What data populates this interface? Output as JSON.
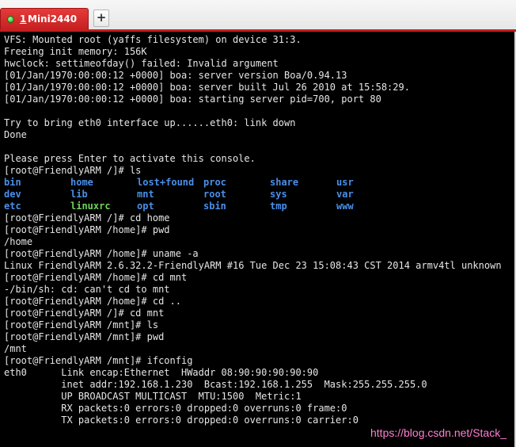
{
  "tabs": [
    {
      "number": "1",
      "title": "Mini2440",
      "status_color": "#2bbf2b",
      "active": true
    }
  ],
  "new_tab_label": "+",
  "terminal": {
    "lines_before_ls": [
      "VFS: Mounted root (yaffs filesystem) on device 31:3.",
      "Freeing init memory: 156K",
      "hwclock: settimeofday() failed: Invalid argument",
      "[01/Jan/1970:00:00:12 +0000] boa: server version Boa/0.94.13",
      "[01/Jan/1970:00:00:12 +0000] boa: server built Jul 26 2010 at 15:58:29.",
      "[01/Jan/1970:00:00:12 +0000] boa: starting server pid=700, port 80",
      "",
      "Try to bring eth0 interface up......eth0: link down",
      "Done",
      "",
      "Please press Enter to activate this console.",
      "[root@FriendlyARM /]# ls"
    ],
    "ls_rows": [
      [
        "bin",
        "home",
        "lost+found",
        "proc",
        "share",
        "usr"
      ],
      [
        "dev",
        "lib",
        "mnt",
        "root",
        "sys",
        "var"
      ],
      [
        "etc",
        "linuxrc",
        "opt",
        "sbin",
        "tmp",
        "www"
      ]
    ],
    "ls_executable": "linuxrc",
    "lines_after_ls": [
      "[root@FriendlyARM /]# cd home",
      "[root@FriendlyARM /home]# pwd",
      "/home",
      "[root@FriendlyARM /home]# uname -a",
      "Linux FriendlyARM 2.6.32.2-FriendlyARM #16 Tue Dec 23 15:08:43 CST 2014 armv4tl unknown",
      "[root@FriendlyARM /home]# cd mnt",
      "-/bin/sh: cd: can't cd to mnt",
      "[root@FriendlyARM /home]# cd ..",
      "[root@FriendlyARM /]# cd mnt",
      "[root@FriendlyARM /mnt]# ls",
      "[root@FriendlyARM /mnt]# pwd",
      "/mnt",
      "[root@FriendlyARM /mnt]# ifconfig",
      "eth0      Link encap:Ethernet  HWaddr 08:90:90:90:90:90",
      "          inet addr:192.168.1.230  Bcast:192.168.1.255  Mask:255.255.255.0",
      "          UP BROADCAST MULTICAST  MTU:1500  Metric:1",
      "          RX packets:0 errors:0 dropped:0 overruns:0 frame:0",
      "          TX packets:0 errors:0 dropped:0 overruns:0 carrier:0"
    ],
    "colors": {
      "background": "#000000",
      "foreground": "#e6e6e6",
      "directory": "#4a8fe8",
      "executable": "#6fd35a"
    }
  },
  "watermark": "https://blog.csdn.net/Stack_",
  "accent_color": "#c41f1f"
}
